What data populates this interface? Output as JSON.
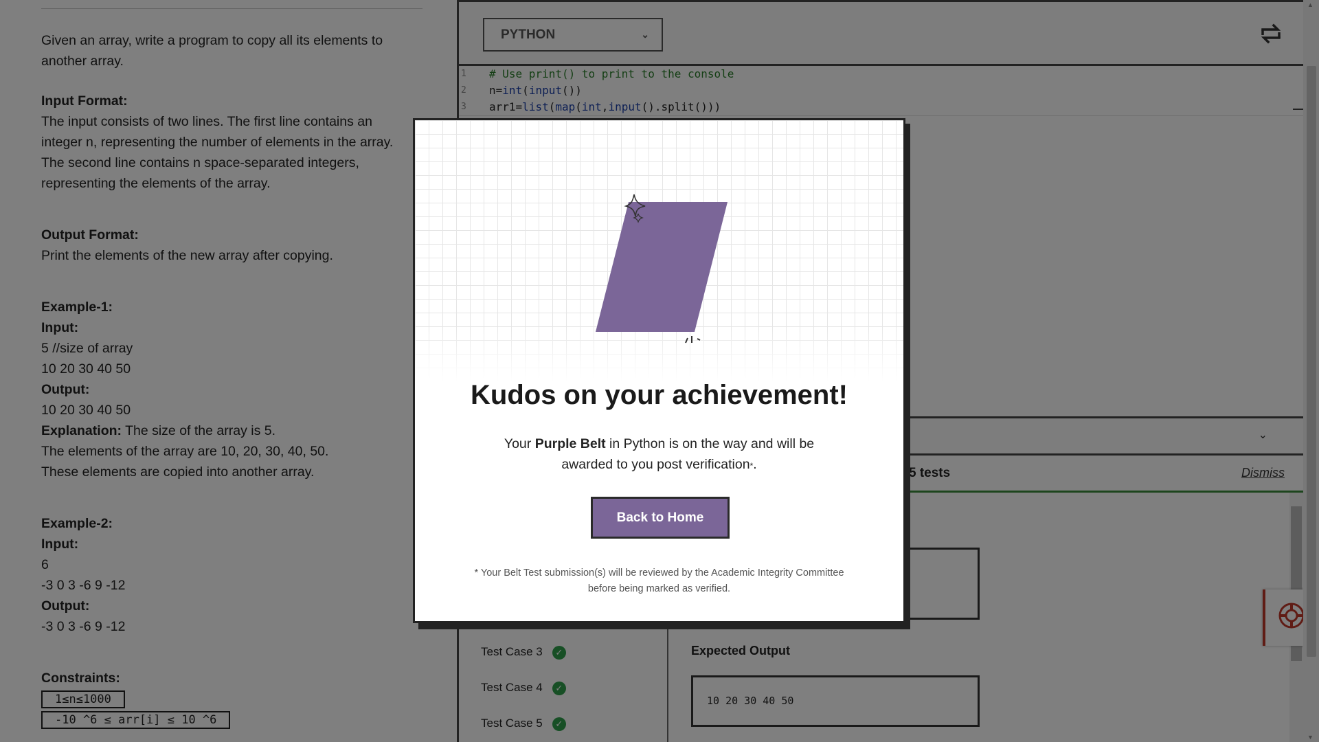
{
  "problem": {
    "statement": "Given an array, write a program to copy all its elements to another array.",
    "input_format_label": "Input Format:",
    "input_format_text": "The input consists of two lines. The first line contains an integer n, representing the number of elements in the array. The second line contains n space-separated integers, representing the elements of the array.",
    "output_format_label": "Output Format:",
    "output_format_text": "Print the elements of the new array after copying.",
    "example1": {
      "title": "Example-1:",
      "input_label": "Input:",
      "input_line1": "5 //size of array",
      "input_line2": "10 20 30 40 50",
      "output_label": "Output:",
      "output_line": "10 20 30 40 50",
      "explanation_label": "Explanation:",
      "explanation_line1": " The size of the array is 5.",
      "explanation_line2": "The elements of the array are 10, 20, 30, 40, 50.",
      "explanation_line3": "These elements are copied into another array."
    },
    "example2": {
      "title": "Example-2:",
      "input_label": "Input:",
      "input_line1": "6",
      "input_line2": "-3 0 3 -6 9 -12",
      "output_label": "Output:",
      "output_line": "-3 0 3 -6 9 -12"
    },
    "constraints_label": "Constraints:",
    "constraint1": "1≤n≤1000",
    "constraint2": "-10 ^6 ≤ arr[i] ≤ 10 ^6"
  },
  "editor": {
    "language": "PYTHON",
    "code_lines": [
      {
        "num": "1",
        "text": "# Use print() to print to the console"
      },
      {
        "num": "2",
        "text": "n=int(input())"
      },
      {
        "num": "3",
        "text": "arr1=list(map(int,input().split()))"
      }
    ]
  },
  "results": {
    "summary_partial": "5 tests",
    "dismiss": "Dismiss",
    "test_cases": [
      "Test Case 3",
      "Test Case 4",
      "Test Case 5"
    ],
    "expected_output_label": "Expected Output",
    "expected_output_value": "10 20 30 40 50"
  },
  "modal": {
    "title": "Kudos on your achievement!",
    "msg_prefix": "Your ",
    "belt_name": "Purple Belt",
    "msg_middle": " in Python is on the way and will be awarded to you post verification",
    "msg_asterisk": "*",
    "msg_end": ".",
    "button_label": "Back to Home",
    "footnote_line1": "* Your Belt Test submission(s) will be reviewed by the Academic Integrity Committee",
    "footnote_line2": "before being marked as verified.",
    "belt_color": "#7b6698"
  },
  "colors": {
    "accent_purple": "#7b6698",
    "success_green": "#2e9e4a",
    "help_red": "#c0392b"
  },
  "icons": [
    "swap-icon",
    "chevron-down-icon",
    "check-circle-icon",
    "lifebuoy-icon",
    "sparkle-icon"
  ]
}
